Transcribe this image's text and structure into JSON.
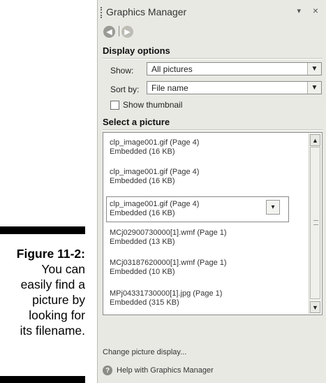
{
  "caption": {
    "figure": "Figure 11-2:",
    "text": "You can\neasily find a\npicture by\nlooking for\nits filename."
  },
  "pane": {
    "title": "Graphics Manager",
    "menu_glyph": "▾",
    "close_glyph": "×",
    "back_glyph": "◀",
    "forward_glyph": "▶"
  },
  "display_options": {
    "heading": "Display options",
    "show_label": "Show:",
    "show_value": "All pictures",
    "sort_label": "Sort by:",
    "sort_value": "File name",
    "thumbnail_label": "Show thumbnail"
  },
  "select_picture": {
    "heading": "Select a picture",
    "items": [
      {
        "name": "clp_image001.gif (Page 4)",
        "detail": "Embedded (16 KB)"
      },
      {
        "name": "clp_image001.gif (Page 4)",
        "detail": "Embedded (16 KB)"
      },
      {
        "name": "clp_image001.gif (Page 4)",
        "detail": "Embedded (16 KB)"
      },
      {
        "name": "MCj02900730000[1].wmf (Page 1)",
        "detail": "Embedded (13 KB)"
      },
      {
        "name": "MCj03187620000[1].wmf (Page 1)",
        "detail": "Embedded (10 KB)"
      },
      {
        "name": "MPj04331730000[1].jpg (Page 1)",
        "detail": "Embedded (315 KB)"
      }
    ],
    "dropdown_glyph": "▾"
  },
  "footer": {
    "change_display": "Change picture display...",
    "help": "Help with Graphics Manager",
    "help_icon_glyph": "?"
  },
  "icons": {
    "scroll_up": "▲",
    "scroll_down": "▼",
    "select_arrow": "▼"
  }
}
